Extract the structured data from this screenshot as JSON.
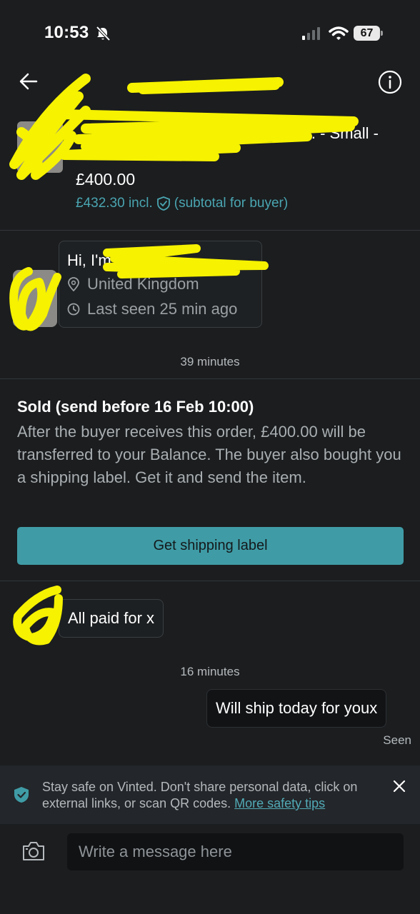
{
  "status_bar": {
    "time": "10:53",
    "battery": "67"
  },
  "header": {
    "title": ""
  },
  "item": {
    "title": "... - Small -",
    "price": "£400.00",
    "total": "£432.30 incl.",
    "total_note": "(subtotal for buyer)"
  },
  "profile": {
    "greeting": "Hi, I'm",
    "location": "United Kingdom",
    "last_seen": "Last seen 25 min ago"
  },
  "timestamps": {
    "first": "39 minutes",
    "second": "16 minutes"
  },
  "order": {
    "title": "Sold (send before 16 Feb 10:00)",
    "body": "After the buyer receives this order, £400.00 will be transferred to your Balance. The buyer also bought you a shipping label. Get it and send the item.",
    "button_label": "Get shipping label"
  },
  "messages": {
    "incoming": "All paid for x",
    "outgoing": "Will ship today for youx",
    "seen": "Seen"
  },
  "safety_banner": {
    "text": "Stay safe on Vinted. Don't share personal data, click on external links, or scan QR codes.",
    "link": "More safety tips"
  },
  "composer": {
    "placeholder": "Write a message here"
  },
  "colors": {
    "background": "#1b1d1f",
    "accent": "#3f9ca6",
    "link": "#52aab6",
    "redaction": "#f6f200"
  }
}
